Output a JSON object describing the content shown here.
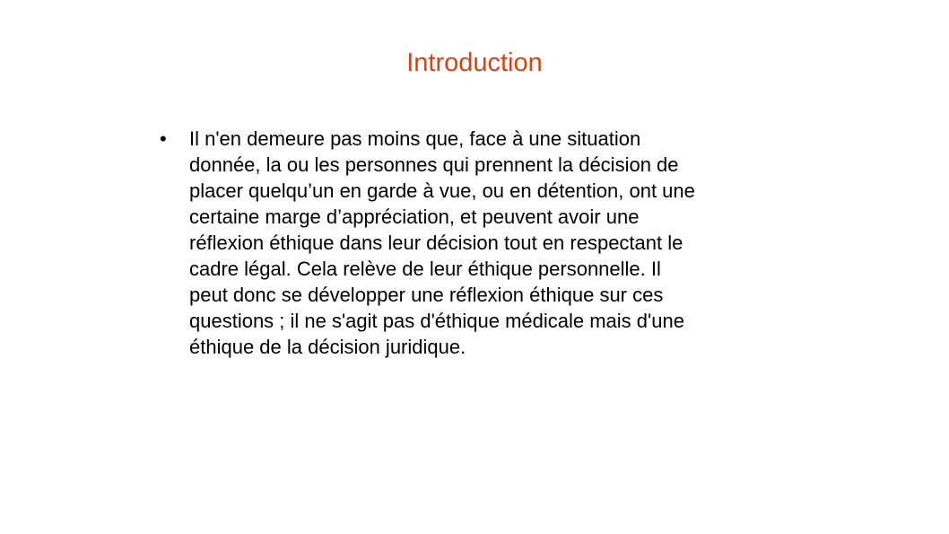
{
  "slide": {
    "title": "Introduction",
    "title_color": "#e0400f",
    "bullet_glyph": "•",
    "bullets": [
      {
        "text": "Il n'en demeure pas moins que, face à une situation\ndonnée, la ou les personnes qui prennent la décision de\nplacer quelqu’un en garde à vue, ou en détention, ont une\ncertaine marge d’appréciation, et peuvent avoir une\nréflexion éthique dans leur décision tout en respectant le\ncadre légal. Cela relève de leur éthique personnelle. Il\npeut donc se développer une réflexion éthique sur ces\nquestions ; il ne s'agit pas d'éthique médicale mais d'une\néthique de la décision juridique."
      }
    ]
  }
}
